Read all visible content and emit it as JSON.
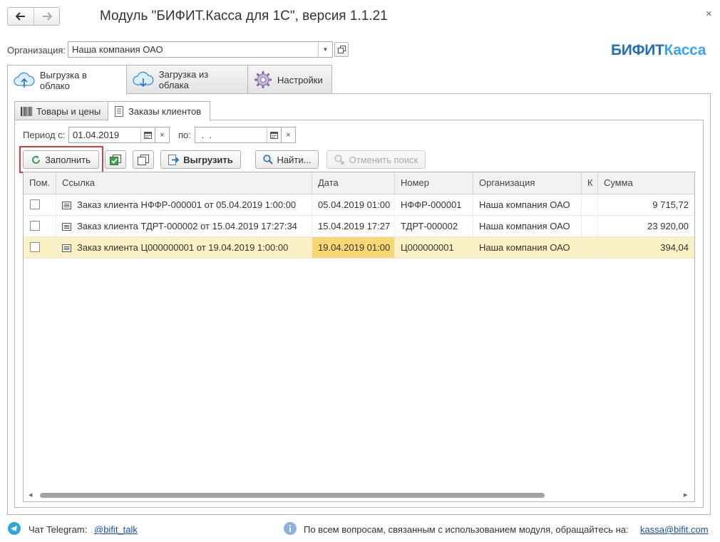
{
  "window": {
    "title": "Модуль \"БИФИТ.Касса для 1С\", версия 1.1.21",
    "close": "×"
  },
  "organization": {
    "label": "Организация:",
    "value": "Наша компания ОАО"
  },
  "logo": {
    "part1": "БИФИТ",
    "part2": "Касса"
  },
  "main_tabs": [
    {
      "label": "Выгрузка в облако",
      "active": true
    },
    {
      "label": "Загрузка из облака",
      "active": false
    },
    {
      "label": "Настройки",
      "active": false
    }
  ],
  "sub_tabs": [
    {
      "label": "Товары и цены",
      "active": false
    },
    {
      "label": "Заказы клиентов",
      "active": true
    }
  ],
  "period": {
    "from_label": "Период с:",
    "from_value": "01.04.2019",
    "to_label": "по:",
    "to_value": " .  .",
    "clear": "×"
  },
  "toolbar": {
    "fill": "Заполнить",
    "upload": "Выгрузить",
    "find": "Найти...",
    "cancel_search": "Отменить поиск"
  },
  "table": {
    "columns": [
      "Пом.",
      "Ссылка",
      "Дата",
      "Номер",
      "Организация",
      "К",
      "Сумма"
    ],
    "rows": [
      {
        "ref": "Заказ клиента НФФР-000001 от 05.04.2019 1:00:00",
        "date": "05.04.2019 01:00",
        "number": "НФФР-000001",
        "org": "Наша компания ОАО",
        "k": "",
        "sum": "9 715,72",
        "selected": false
      },
      {
        "ref": "Заказ клиента ТДРТ-000002 от 15.04.2019 17:27:34",
        "date": "15.04.2019 17:27",
        "number": "ТДРТ-000002",
        "org": "Наша компания ОАО",
        "k": "",
        "sum": "23 920,00",
        "selected": false
      },
      {
        "ref": "Заказ клиента Ц000000001 от 19.04.2019 1:00:00",
        "date": "19.04.2019 01:00",
        "number": "Ц000000001",
        "org": "Наша компания ОАО",
        "k": "",
        "sum": "394,04",
        "selected": true
      }
    ]
  },
  "footer": {
    "telegram_label": "Чат Telegram:",
    "telegram_link": "@bifit_talk",
    "info_text": "По всем вопросам, связанным с использованием модуля, обращайтесь на:",
    "email": "kassa@bifit.com"
  },
  "colors": {
    "accent": "#2a8ed8",
    "selected_row": "#fbf1c4",
    "selected_cell": "#f8d774",
    "highlight": "#e0393e"
  }
}
